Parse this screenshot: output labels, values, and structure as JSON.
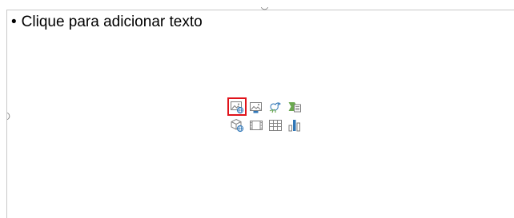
{
  "slide": {
    "placeholder_text": "Clique para adicionar texto",
    "bullet_char": "•"
  },
  "content_icons": [
    {
      "name": "picture-from-file-icon",
      "selected": true
    },
    {
      "name": "stock-images-icon",
      "selected": false
    },
    {
      "name": "online-pictures-icon",
      "selected": false
    },
    {
      "name": "smartart-graphic-icon",
      "selected": false
    },
    {
      "name": "3d-models-icon",
      "selected": false
    },
    {
      "name": "insert-video-icon",
      "selected": false
    },
    {
      "name": "insert-table-icon",
      "selected": false
    },
    {
      "name": "insert-chart-icon",
      "selected": false
    }
  ],
  "colors": {
    "accent_blue": "#2e75b6",
    "accent_green": "#6aa84f",
    "selection_red": "#e0131b",
    "icon_gray": "#7f7f7f"
  }
}
